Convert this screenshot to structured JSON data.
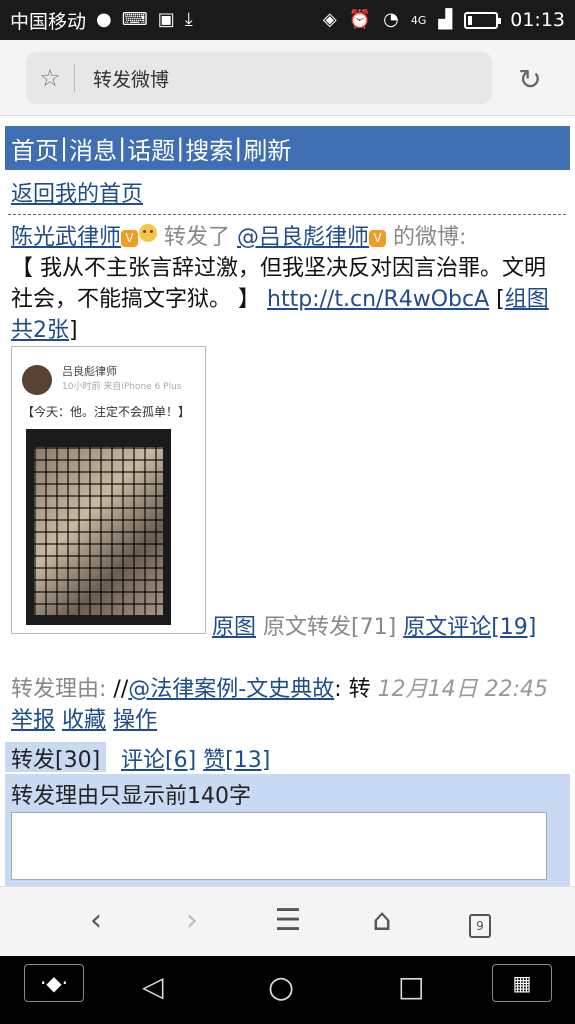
{
  "status": {
    "carrier": "中国移动",
    "network": "4G",
    "time": "01:13"
  },
  "browser": {
    "page_title": "转发微博",
    "tab_count": "9"
  },
  "nav": {
    "items": [
      "首页",
      "消息",
      "话题",
      "搜索",
      "刷新"
    ],
    "back_link": "返回我的首页"
  },
  "post": {
    "author": "陈光武律师",
    "action": "转发了",
    "mention": "@吕良彪律师",
    "suffix": "的微博:",
    "text": "【 我从不主张言辞过激，但我坚决反对因言治罪。文明社会，不能搞文字狱。 】",
    "link": "http://t.cn/R4wObcA",
    "group_link": "组图共2张",
    "thumbnail": {
      "name": "吕良彪律师",
      "meta": "10小时前  来自iPhone 6 Plus",
      "quote": "【今天：他。注定不会孤单！】"
    },
    "original_image": "原图",
    "original_repost": "原文转发[71]",
    "original_comment": "原文评论[19]",
    "reason_label": "转发理由:",
    "reason_prefix": "//",
    "reason_mention": "@法律案例-文史典故",
    "reason_text": ": 转",
    "date": "12月14日 22:45",
    "report": "举报",
    "favorite": "收藏",
    "operate": "操作"
  },
  "tabs": {
    "repost": "转发[30]",
    "comment": "评论[6]",
    "like": "赞[13]"
  },
  "form": {
    "hint": "转发理由只显示前140字"
  }
}
